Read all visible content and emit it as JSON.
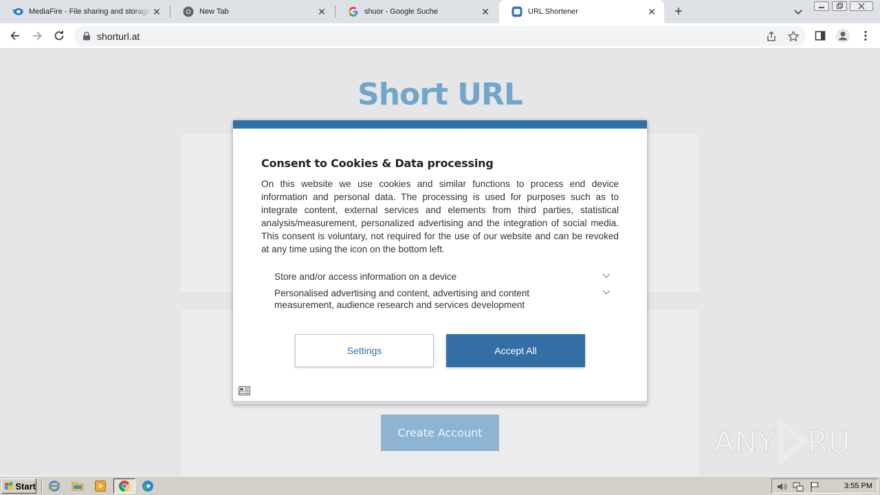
{
  "browser": {
    "tabs": [
      {
        "title": "MediaFire - File sharing and storage",
        "favicon": "mediafire-icon",
        "active": false
      },
      {
        "title": "New Tab",
        "favicon": "chrome-icon",
        "active": false
      },
      {
        "title": "shuor - Google Suche",
        "favicon": "google-icon",
        "active": false
      },
      {
        "title": "URL Shortener",
        "favicon": "shorturl-icon",
        "active": true
      }
    ],
    "address": "shorturl.at"
  },
  "page": {
    "title": "Short URL",
    "create_account": "Create Account",
    "watermark": "ANY RUN"
  },
  "consent": {
    "heading": "Consent to Cookies & Data processing",
    "body": "On this website we use cookies and similar functions to process end device information and personal data. The processing is used for purposes such as to integrate content, external services and elements from third parties, statistical analysis/measurement, personalized advertising and the integration of social media. This consent is voluntary, not required for the use of our website and can be revoked at any time using the icon on the bottom left.",
    "purposes": [
      "Store and/or access information on a device",
      "Personalised advertising and content, advertising and content measurement, audience research and services development"
    ],
    "settings_label": "Settings",
    "accept_label": "Accept All",
    "accent_color": "#336fa5"
  },
  "taskbar": {
    "start_label": "Start",
    "clock": "3:55 PM"
  }
}
